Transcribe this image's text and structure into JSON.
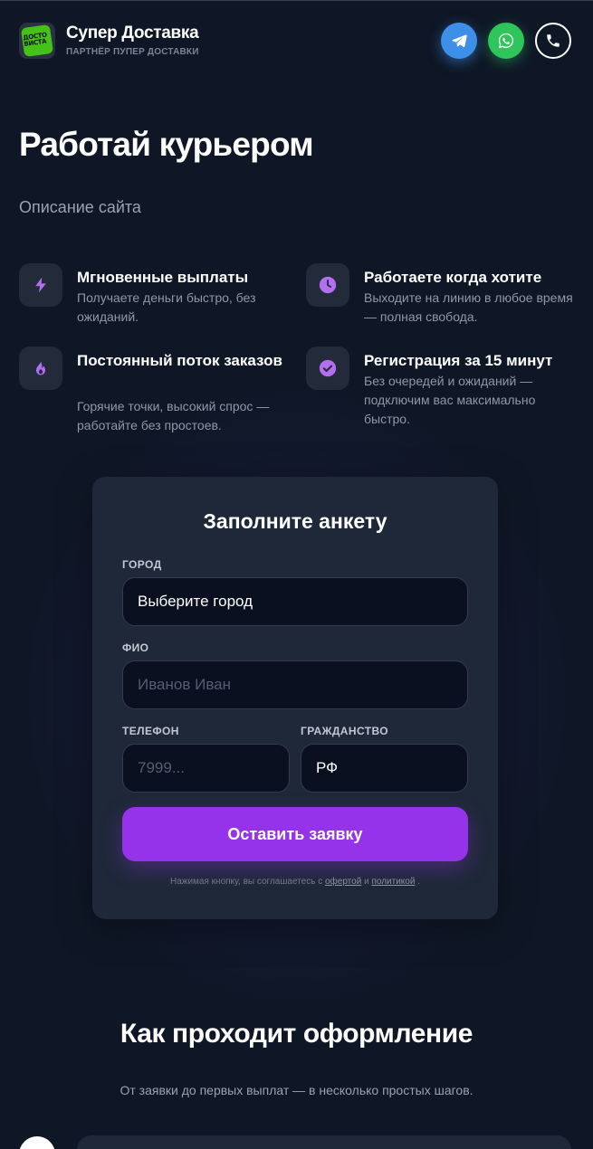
{
  "header": {
    "logo_text": "ДОСТО ВИСТА",
    "title": "Супер Доставка",
    "subtitle": "ПАРТНЁР ПУПЕР ДОСТАВКИ",
    "social": [
      {
        "name": "telegram-icon",
        "color": "#3d8fe8"
      },
      {
        "name": "whatsapp-icon",
        "color": "#2ec55a"
      },
      {
        "name": "phone-icon",
        "color": "#ffffff"
      }
    ]
  },
  "hero": {
    "title": "Работай курьером",
    "description": "Описание сайта"
  },
  "features": [
    {
      "icon": "lightning-icon",
      "title": "Мгновенные выплаты",
      "description": "Получаете деньги быстро, без ожиданий."
    },
    {
      "icon": "clock-icon",
      "title": "Работаете когда хотите",
      "description": "Выходите на линию в любое время — полная свобода."
    },
    {
      "icon": "fire-icon",
      "title": "Постоянный поток заказов",
      "description": "Горячие точки, высокий спрос — работайте без простоев."
    },
    {
      "icon": "check-circle-icon",
      "title": "Регистрация за 15 минут",
      "description": "Без очередей и ожиданий — подключим вас максимально быстро."
    }
  ],
  "form": {
    "title": "Заполните анкету",
    "city_label": "ГОРОД",
    "city_value": "Выберите город",
    "name_label": "ФИО",
    "name_placeholder": "Иванов Иван",
    "phone_label": "ТЕЛЕФОН",
    "phone_placeholder": "7999...",
    "citizenship_label": "ГРАЖДАНСТВО",
    "citizenship_value": "РФ",
    "submit_label": "Оставить заявку",
    "consent_prefix": "Нажимая кнопку, вы соглашаетесь с",
    "consent_offer": "офертой",
    "consent_and": "и",
    "consent_policy": "политикой",
    "consent_suffix": "."
  },
  "steps": {
    "title": "Как проходит оформление",
    "description": "От заявки до первых выплат — в несколько простых шагов."
  },
  "colors": {
    "background": "#0f1726",
    "accent": "#9533ea",
    "card": "#1e2838",
    "icon_accent": "#b36ff0"
  }
}
